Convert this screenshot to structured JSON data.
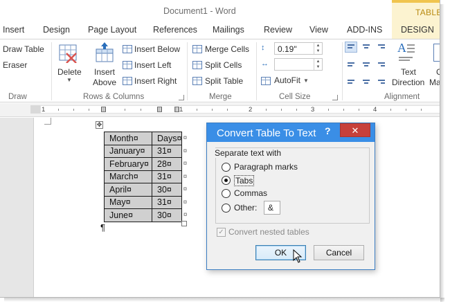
{
  "window": {
    "title": "Document1 - Word",
    "contextual_tab_group": "TABLE"
  },
  "tabs": [
    "Insert",
    "Design",
    "Page Layout",
    "References",
    "Mailings",
    "Review",
    "View",
    "ADD-INS",
    "DESIGN"
  ],
  "ribbon": {
    "draw": {
      "label": "Draw",
      "draw_table": "Draw Table",
      "eraser": "Eraser"
    },
    "rows_columns": {
      "label": "Rows & Columns",
      "delete": "Delete",
      "insert_above_line1": "Insert",
      "insert_above_line2": "Above",
      "insert_below": "Insert Below",
      "insert_left": "Insert Left",
      "insert_right": "Insert Right"
    },
    "merge": {
      "label": "Merge",
      "merge_cells": "Merge Cells",
      "split_cells": "Split Cells",
      "split_table": "Split Table"
    },
    "cell_size": {
      "label": "Cell Size",
      "height_value": "0.19\"",
      "width_value": "",
      "autofit": "AutoFit"
    },
    "alignment": {
      "label": "Alignment",
      "text_direction_line1": "Text",
      "text_direction_line2": "Direction",
      "cell_margins_partial_1": "C",
      "cell_margins_partial_2": "Ma"
    }
  },
  "ruler": {
    "numbers": [
      "1",
      "1",
      "2",
      "3",
      "4"
    ]
  },
  "table": {
    "rows": [
      [
        "Month¤",
        "Days¤"
      ],
      [
        "January¤",
        "31¤"
      ],
      [
        "February¤",
        "28¤"
      ],
      [
        "March¤",
        "31¤"
      ],
      [
        "April¤",
        "30¤"
      ],
      [
        "May¤",
        "31¤"
      ],
      [
        "June¤",
        "30¤"
      ]
    ],
    "end_of_row_mark": "¤",
    "paragraph_mark": "¶"
  },
  "dialog": {
    "title": "Convert Table To Text",
    "help": "?",
    "close": "✕",
    "section_label": "Separate text with",
    "options": {
      "paragraph_marks": "Paragraph marks",
      "tabs": "Tabs",
      "commas": "Commas",
      "other": "Other:"
    },
    "selected": "tabs",
    "other_value": "&",
    "convert_nested": "Convert nested tables",
    "ok": "OK",
    "cancel": "Cancel"
  }
}
